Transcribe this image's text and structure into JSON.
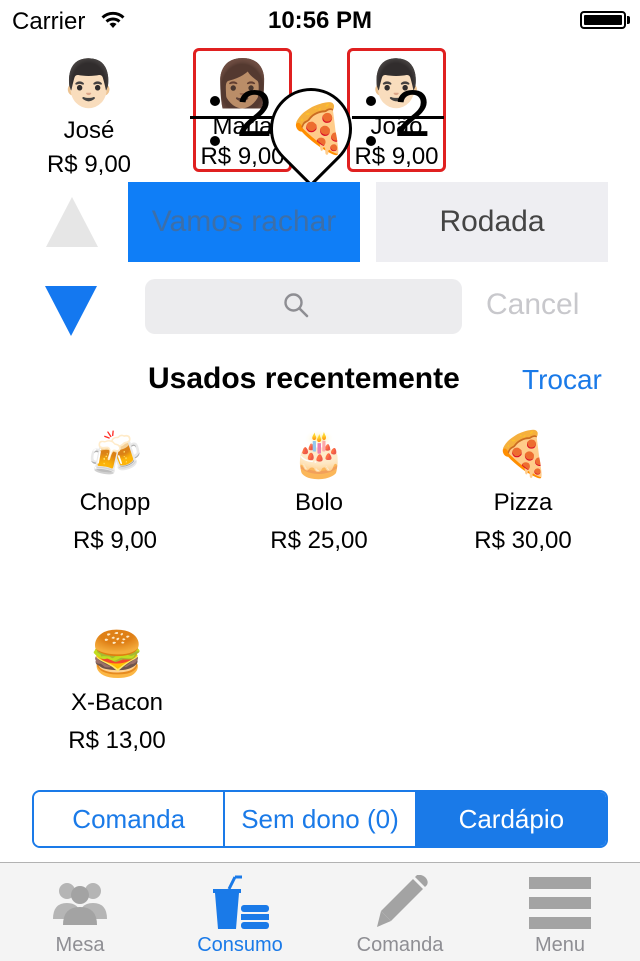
{
  "status_bar": {
    "carrier": "Carrier",
    "time": "10:56 PM"
  },
  "people": [
    {
      "name": "José",
      "price": "R$ 9,00",
      "emoji": "👨🏻"
    },
    {
      "name": "Maria",
      "price": "R$ 9,00",
      "emoji": "👩🏽"
    },
    {
      "name": "João",
      "price": "R$ 9,00",
      "emoji": "👨🏻"
    }
  ],
  "split_overlay": {
    "left_divisor": "2",
    "right_divisor": "2",
    "emoji": "🍕"
  },
  "mode": {
    "vamos_rachar": "Vamos rachar",
    "rodada": "Rodada"
  },
  "search": {
    "placeholder": "",
    "cancel": "Cancel"
  },
  "recent": {
    "title": "Usados recentemente",
    "action": "Trocar",
    "items": [
      {
        "emoji": "🍻",
        "name": "Chopp",
        "price": "R$ 9,00"
      },
      {
        "emoji": "🎂",
        "name": "Bolo",
        "price": "R$ 25,00"
      },
      {
        "emoji": "🍕",
        "name": "Pizza",
        "price": "R$ 30,00"
      },
      {
        "emoji": "🍔",
        "name": "X-Bacon",
        "price": "R$ 13,00"
      }
    ]
  },
  "segmented": {
    "items": [
      "Comanda",
      "Sem dono (0)",
      "Cardápio"
    ],
    "selected": "Cardápio"
  },
  "tab_bar": {
    "items": [
      {
        "label": "Mesa",
        "icon": "people-icon"
      },
      {
        "label": "Consumo",
        "icon": "drink-food-icon"
      },
      {
        "label": "Comanda",
        "icon": "pencil-icon"
      },
      {
        "label": "Menu",
        "icon": "menu-icon"
      }
    ],
    "active": "Consumo"
  },
  "colors": {
    "accent": "#1a7ae8",
    "selected_border": "#e02020",
    "button_blue": "#0f7ef7"
  }
}
